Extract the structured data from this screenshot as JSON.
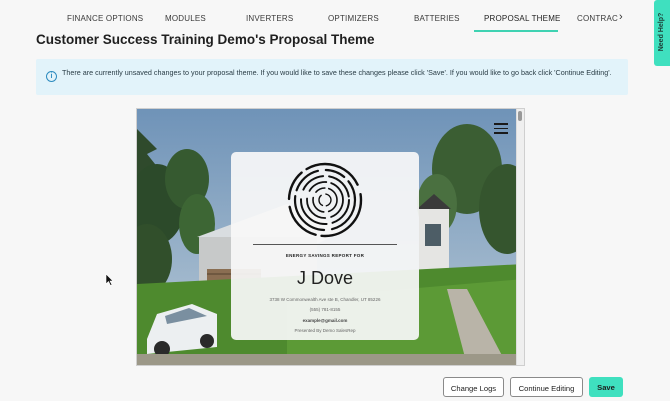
{
  "tabs": [
    {
      "label": "FINANCE OPTIONS",
      "active": false
    },
    {
      "label": "MODULES",
      "active": false
    },
    {
      "label": "INVERTERS",
      "active": false
    },
    {
      "label": "OPTIMIZERS",
      "active": false
    },
    {
      "label": "BATTERIES",
      "active": false
    },
    {
      "label": "PROPOSAL THEME",
      "active": true
    },
    {
      "label": "CONTRAC",
      "active": false
    }
  ],
  "page_title": "Customer Success Training Demo's Proposal Theme",
  "notice": {
    "text": "There are currently unsaved changes to your proposal theme. If you would like to save these changes please click 'Save'. If you would like to go back click 'Continue Editing'."
  },
  "preview": {
    "card": {
      "tagline": "ENERGY SAVINGS REPORT FOR",
      "customer_name": "J Dove",
      "address": "3738 W Commonwealth Ave ste B, Chandler, UT 85226",
      "phone": "(555) 781-8155",
      "email": "example@gmail.com",
      "presented_by": "Presented By Demo SalesRep"
    }
  },
  "actions": {
    "change_logs": "Change Logs",
    "continue_editing": "Continue Editing",
    "save": "Save"
  },
  "help_tab": "Need Help?",
  "colors": {
    "accent": "#3fe0bf",
    "tab_underline": "#3fd2b2",
    "notice_bg": "#e2f3fa",
    "notice_icon": "#2d8bbf"
  }
}
